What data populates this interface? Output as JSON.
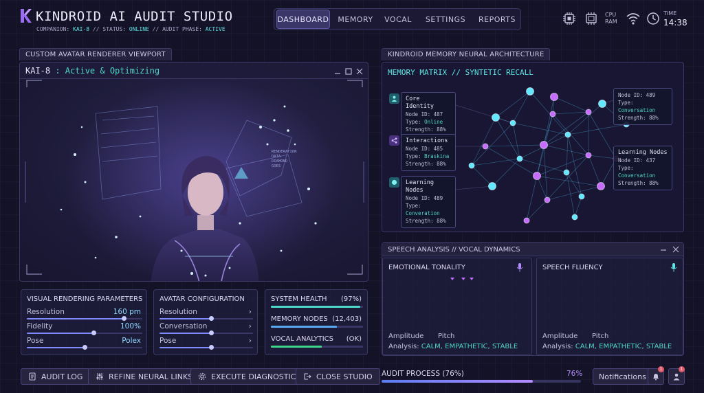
{
  "header": {
    "app_title": "KINDROID AI AUDIT STUDIO",
    "companion_prefix": "COMPANION:",
    "companion": "KAI-8",
    "status_prefix": "// STATUS:",
    "status": "ONLINE",
    "phase_prefix": "// AUDIT PHASE:",
    "phase": "ACTIVE",
    "nav": [
      "DASHBOARD",
      "MEMORY",
      "VOCAL",
      "SETTINGS",
      "REPORTS"
    ],
    "cpu_label": "CPU",
    "ram_label": "RAM",
    "time_label": "TIME",
    "time_value": "14:38"
  },
  "viewport": {
    "tab_title": "CUSTOM AVATAR RENDERER VIEWPORT",
    "window_name": "KAI-8",
    "window_status": ": Active & Optimizing",
    "overlay_text": [
      "RENDERATION",
      "DATA",
      "DIAMOND",
      "GOES"
    ]
  },
  "visual_params": {
    "title": "VISUAL RENDERING PARAMETERS",
    "rows": [
      {
        "label": "Resolution",
        "value": "160 pm",
        "level": 0.84
      },
      {
        "label": "Fidelity",
        "value": "100%",
        "level": 0.58
      },
      {
        "label": "Pose",
        "value": "Polex",
        "level": 0.5
      }
    ]
  },
  "avatar_config": {
    "title": "AVATAR CONFIGURATION",
    "rows": [
      {
        "label": "Resolution",
        "level": 0.55
      },
      {
        "label": "Conversation",
        "level": 0.55
      },
      {
        "label": "Pose",
        "level": 0.55
      }
    ]
  },
  "system": {
    "rows": [
      {
        "label": "SYSTEM HEALTH",
        "value": "(97%)",
        "level": 0.97,
        "color": "#4fd6c8"
      },
      {
        "label": "MEMORY NODES",
        "value": "(12,403)",
        "level": 0.72,
        "color": "#5aa8f0"
      },
      {
        "label": "VOCAL ANALYTICS",
        "value": "(OK)",
        "level": 0.55,
        "color": "#3ed68a"
      }
    ]
  },
  "memory": {
    "tab_title": "KINDROID MEMORY NEURAL ARCHITECTURE",
    "header": "MEMORY MATRIX // SYNTETIC RECALL",
    "cards": [
      {
        "title": "Core Identity",
        "id": "487",
        "type": "Online",
        "strength": "88%",
        "icon": "person-icon"
      },
      {
        "title": "Interactions",
        "id": "485",
        "type": "Braskina",
        "strength": "88%",
        "icon": "share-icon"
      },
      {
        "title": "Learning Nodes",
        "id": "489",
        "type": "Converation",
        "strength": "88%",
        "icon": "globe-icon"
      }
    ],
    "right_cards": [
      {
        "id": "489",
        "type": "Conversation",
        "strength": "88%"
      },
      {
        "title": "Learning Nodes",
        "id": "437",
        "type": "Conversation",
        "strength": "88%"
      }
    ],
    "labels": {
      "node_id": "Node ID:",
      "type": "Type:",
      "strength": "Strength:"
    }
  },
  "speech": {
    "tab_title": "SPEECH ANALYSIS // VOCAL DYNAMICS",
    "panels": [
      {
        "title": "EMOTIONAL TONALITY",
        "amp": "Amplitude",
        "pitch": "Pitch",
        "analysis_label": "Analysis:",
        "analysis": "CALM, EMPATHETIC, STABLE"
      },
      {
        "title": "SPEECH FLUENCY",
        "amp": "Amplitude",
        "pitch": "Pitch",
        "analysis_label": "Analysis:",
        "analysis": "CALM, EMPATHETIC, STABLE"
      }
    ]
  },
  "footer": {
    "buttons": [
      "AUDIT LOG",
      "REFINE NEURAL LINKS",
      "EXECUTE DIAGNOSTICS",
      "CLOSE STUDIO"
    ],
    "progress_label": "AUDIT PROCESS (76%)",
    "progress_value": "76%",
    "progress": 0.76,
    "notifications": "Notifications",
    "badge_1": "1",
    "badge_2": "1"
  },
  "colors": {
    "accent": "#5de6e6",
    "purple": "#9a6cf0",
    "panel_border": "#3c3866"
  }
}
